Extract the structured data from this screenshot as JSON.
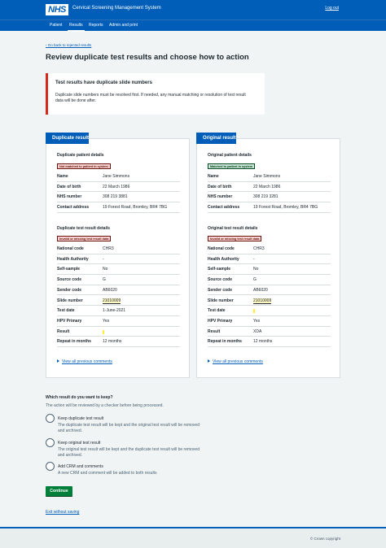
{
  "header": {
    "logo": "NHS",
    "service_name": "Cervical Screening Management System",
    "logout": "Log out"
  },
  "nav": {
    "items": [
      {
        "label": "Patient"
      },
      {
        "label": "Results",
        "active": true
      },
      {
        "label": "Reports"
      },
      {
        "label": "Admin and print"
      }
    ]
  },
  "back_link": "Go back to rejected results",
  "page_title": "Review duplicate test results and choose how to action",
  "warning": {
    "title": "Test results have duplicate slide numbers",
    "body": "Duplicate slide numbers must be resolved first. If needed, any manual matching or resolution of test result data will be done after."
  },
  "duplicate": {
    "heading": "Duplicate result",
    "patient_title": "Duplicate patient details",
    "patient_tag": "Not matched to patient in system",
    "patient_rows": [
      {
        "key": "Name",
        "value": "Jane Simmons"
      },
      {
        "key": "Date of birth",
        "value": "22 March 1986"
      },
      {
        "key": "NHS number",
        "value": "308 219 3881"
      },
      {
        "key": "Contact address",
        "value": "19 Forest Road, Bromley, BR4 7BG"
      }
    ],
    "test_title": "Duplicate test result details",
    "test_tag": "Invalid or missing test result data",
    "test_rows": [
      {
        "key": "National code",
        "value": "CHR3"
      },
      {
        "key": "Health Authority",
        "value": "-"
      },
      {
        "key": "Self-sample",
        "value": "No"
      },
      {
        "key": "Source code",
        "value": "G"
      },
      {
        "key": "Sender code",
        "value": "AB6020"
      },
      {
        "key": "Slide number",
        "value": "21010009"
      },
      {
        "key": "Test date",
        "value": "1-June-2021"
      },
      {
        "key": "HPV Primary",
        "value": "Yes"
      },
      {
        "key": "Result",
        "value": ""
      },
      {
        "key": "Repeat in months",
        "value": "12 months"
      }
    ],
    "comments_link": "View all previous comments"
  },
  "original": {
    "heading": "Original result",
    "patient_title": "Original patient details",
    "patient_tag": "Matched to patient in system",
    "patient_rows": [
      {
        "key": "Name",
        "value": "Jane Simmons"
      },
      {
        "key": "Date of birth",
        "value": "22 March 1986"
      },
      {
        "key": "NHS number",
        "value": "308 219 3281"
      },
      {
        "key": "Contact address",
        "value": "19 Forest Road, Bromley, BR4 7BG"
      }
    ],
    "test_title": "Original test result details",
    "test_tag": "Invalid or missing test result data",
    "test_rows": [
      {
        "key": "National code",
        "value": "CHR3"
      },
      {
        "key": "Health Authority",
        "value": "-"
      },
      {
        "key": "Self-sample",
        "value": "No"
      },
      {
        "key": "Source code",
        "value": "G"
      },
      {
        "key": "Sender code",
        "value": "AB6020"
      },
      {
        "key": "Slide number",
        "value": "21010009"
      },
      {
        "key": "Test date",
        "value": ""
      },
      {
        "key": "HPV Primary",
        "value": "Yes"
      },
      {
        "key": "Result",
        "value": "XDA"
      },
      {
        "key": "Repeat in months",
        "value": "12 months"
      }
    ],
    "comments_link": "View all previous comments"
  },
  "decision": {
    "question": "Which result do you want to keep?",
    "hint": "The action will be reviewed by a checker before being processed.",
    "options": [
      {
        "label": "Keep duplicate test result",
        "hint": "The duplicate test result will be kept and the original test result will be removed and archived."
      },
      {
        "label": "Keep original test result",
        "hint": "The original test result will be kept and the duplicate test result will be removed and archived."
      },
      {
        "label": "Add CRM and comments",
        "hint": "A new CRM and comment will be added to both results"
      }
    ]
  },
  "continue_button": "Continue",
  "exit_link": "Exit without saving",
  "footer": {
    "copyright": "© Crown copyright"
  },
  "colors": {
    "brand": "#005eb8",
    "error": "#d5281b",
    "success": "#007f3b",
    "background": "#f0f4f5"
  }
}
